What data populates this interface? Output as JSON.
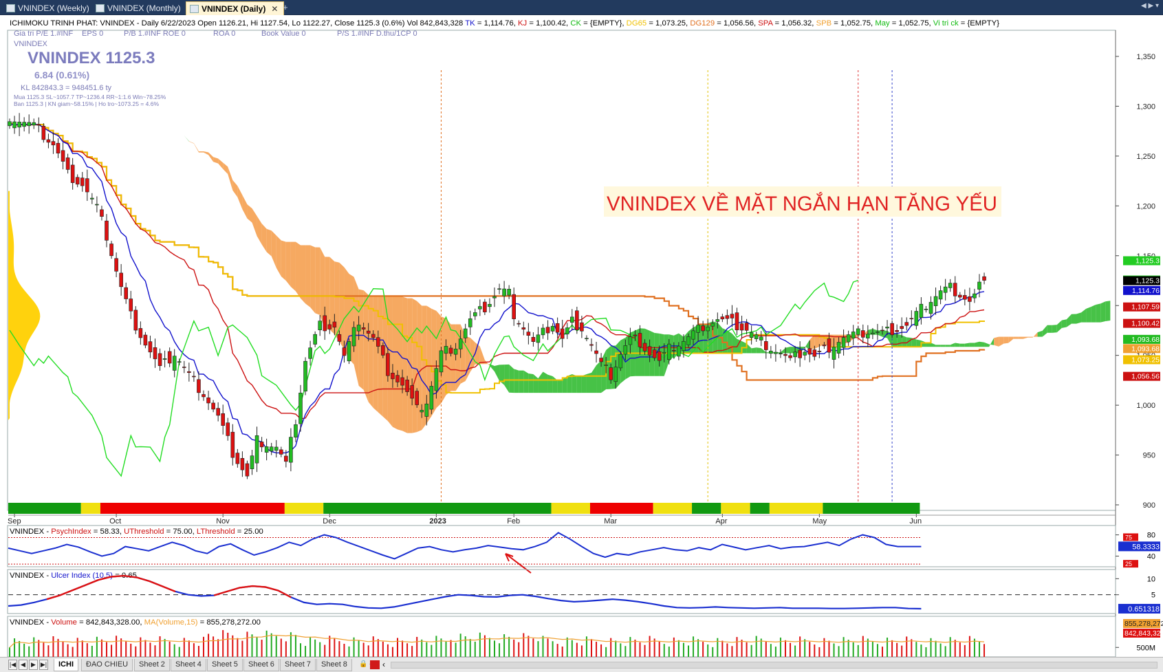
{
  "tabs": [
    {
      "label": "VNINDEX (Weekly)",
      "active": false
    },
    {
      "label": "VNINDEX (Monthly)",
      "active": false
    },
    {
      "label": "VNINDEX (Daily)",
      "active": true
    }
  ],
  "new_tab_symbol": "+",
  "tab_close_symbol": "✕",
  "tab_scroll_symbols": "◀ ▶ ▾",
  "header": {
    "line1": [
      {
        "text": "ICHIMOKU TRINH PHAT: VNINDEX - Daily 6/22/2023 Open 1126.21, Hi 1127.54, Lo 1122.27, Close 1125.3 (0.6%) Vol 842,843,328 ",
        "color": "#000000"
      },
      {
        "text": "TK",
        "color": "#1111cc"
      },
      {
        "text": " = 1,114.76, ",
        "color": "#000000"
      },
      {
        "text": "KJ",
        "color": "#cc1111"
      },
      {
        "text": " = 1,100.42, ",
        "color": "#000000"
      },
      {
        "text": "CK",
        "color": "#11bb11"
      },
      {
        "text": " = {EMPTY}, ",
        "color": "#000000"
      },
      {
        "text": "DG65",
        "color": "#f0c000"
      },
      {
        "text": " = 1,073.25, ",
        "color": "#000000"
      },
      {
        "text": "DG129",
        "color": "#e07020"
      },
      {
        "text": " = 1,056.56, ",
        "color": "#000000"
      },
      {
        "text": "SPA",
        "color": "#cc1111"
      },
      {
        "text": " = 1,056.32, ",
        "color": "#000000"
      },
      {
        "text": "SPB",
        "color": "#f0a030"
      },
      {
        "text": " = 1,052.75, ",
        "color": "#000000"
      },
      {
        "text": "May",
        "color": "#11bb11"
      },
      {
        "text": " = 1,052.75, ",
        "color": "#000000"
      },
      {
        "text": "Vi tri ck",
        "color": "#11bb11"
      },
      {
        "text": " = {EMPTY}",
        "color": "#000000"
      }
    ],
    "line2": [
      "Gia tri P/E 1.#INF",
      "EPS 0",
      "P/B 1.#INF ROE 0",
      "ROA 0",
      "Book Value 0",
      "P/S 1.#INF D.thu/1CP 0"
    ],
    "line3": "VNINDEX",
    "big_title": "VNINDEX 1125.3",
    "change": "6.84 (0.61%)",
    "kl": "KL 842843.3 = 948451.6 ty",
    "mua": "Mua 1125.3   SL~1057.7   TP~1236.4   RR~1:1.6   Win~78.25%",
    "ban": "Ban 1125.3 | KN giam~58.15% | Ho tro~1073.25 = 4.6%"
  },
  "annotation": "VNINDEX VỀ MẶT NGẮN HẠN TĂNG YẾU",
  "colors": {
    "up": "#22bb22",
    "down": "#dd1111",
    "tenkan": "#1111cc",
    "kijun": "#cc1111",
    "chikou": "#22dd22",
    "dg65": "#f0c000",
    "dg129": "#e07020",
    "kumo_bull": "#33bb33",
    "kumo_bear": "#f5a050",
    "accent": "#223a5e"
  },
  "chart_data": [
    {
      "type": "candlestick",
      "title": "ICHIMOKU TRINH PHAT: VNINDEX - Daily",
      "ylim": [
        885,
        1365
      ],
      "ytick_values": [
        900,
        950,
        1000,
        1050,
        1100,
        1150,
        1200,
        1250,
        1300,
        1350
      ],
      "ytick_labels": [
        "900",
        "950",
        "1,000",
        "1,050",
        "1,100",
        "1,150",
        "1,200",
        "1,250",
        "1,300",
        "1,350"
      ],
      "months": [
        {
          "label": "Sep",
          "idx": 1
        },
        {
          "label": "Oct",
          "idx": 22
        },
        {
          "label": "Nov",
          "idx": 44
        },
        {
          "label": "Dec",
          "idx": 66
        },
        {
          "label": "2023",
          "idx": 88
        },
        {
          "label": "Feb",
          "idx": 104
        },
        {
          "label": "Mar",
          "idx": 124
        },
        {
          "label": "Apr",
          "idx": 147
        },
        {
          "label": "May",
          "idx": 167
        },
        {
          "label": "Jun",
          "idx": 187
        }
      ],
      "close_anchors": [
        [
          0,
          1290
        ],
        [
          5,
          1280
        ],
        [
          9,
          1262
        ],
        [
          12,
          1232
        ],
        [
          15,
          1222
        ],
        [
          18,
          1198
        ],
        [
          20,
          1170
        ],
        [
          23,
          1118
        ],
        [
          25,
          1090
        ],
        [
          28,
          1062
        ],
        [
          31,
          1036
        ],
        [
          34,
          1052
        ],
        [
          37,
          1030
        ],
        [
          40,
          1012
        ],
        [
          43,
          988
        ],
        [
          46,
          952
        ],
        [
          49,
          928
        ],
        [
          51,
          965
        ],
        [
          53,
          962
        ],
        [
          55,
          958
        ],
        [
          57,
          940
        ],
        [
          59,
          985
        ],
        [
          61,
          1045
        ],
        [
          64,
          1080
        ],
        [
          67,
          1080
        ],
        [
          69,
          1048
        ],
        [
          72,
          1085
        ],
        [
          75,
          1067
        ],
        [
          78,
          1035
        ],
        [
          81,
          1020
        ],
        [
          84,
          995
        ],
        [
          86,
          1004
        ],
        [
          89,
          1052
        ],
        [
          92,
          1060
        ],
        [
          95,
          1085
        ],
        [
          98,
          1098
        ],
        [
          101,
          1116
        ],
        [
          103,
          1112
        ],
        [
          104,
          1092
        ],
        [
          106,
          1078
        ],
        [
          108,
          1062
        ],
        [
          110,
          1072
        ],
        [
          112,
          1082
        ],
        [
          114,
          1066
        ],
        [
          116,
          1084
        ],
        [
          118,
          1078
        ],
        [
          120,
          1060
        ],
        [
          122,
          1040
        ],
        [
          124,
          1030
        ],
        [
          126,
          1052
        ],
        [
          128,
          1066
        ],
        [
          130,
          1064
        ],
        [
          132,
          1052
        ],
        [
          134,
          1043
        ],
        [
          136,
          1056
        ],
        [
          138,
          1062
        ],
        [
          140,
          1068
        ],
        [
          143,
          1080
        ],
        [
          146,
          1086
        ],
        [
          149,
          1082
        ],
        [
          152,
          1076
        ],
        [
          155,
          1064
        ],
        [
          157,
          1058
        ],
        [
          159,
          1052
        ],
        [
          161,
          1044
        ],
        [
          164,
          1056
        ],
        [
          166,
          1048
        ],
        [
          168,
          1055
        ],
        [
          170,
          1062
        ],
        [
          172,
          1068
        ],
        [
          174,
          1070
        ],
        [
          177,
          1074
        ],
        [
          180,
          1072
        ],
        [
          182,
          1076
        ],
        [
          185,
          1080
        ],
        [
          188,
          1096
        ],
        [
          190,
          1106
        ],
        [
          192,
          1114
        ],
        [
          194,
          1118
        ],
        [
          196,
          1112
        ],
        [
          198,
          1104
        ],
        [
          199,
          1110
        ],
        [
          200,
          1120
        ],
        [
          201,
          1125.3
        ]
      ],
      "price_labels": [
        {
          "value": 1125.3,
          "text": "1,125.3",
          "bg": "#22cc22"
        },
        {
          "value": 1114.76,
          "text": "1,114.76",
          "bg": "#1111cc"
        },
        {
          "value": 1107.59,
          "text": "1,107.59",
          "bg": "#cc1111"
        },
        {
          "value": 1100.42,
          "text": "1,100.42",
          "bg": "#cc1111"
        },
        {
          "value": 1093.68,
          "text": "1,093.68",
          "bg": "#22bb22"
        },
        {
          "value": 1093.68,
          "text": "1,093.68",
          "bg": "#f0a030"
        },
        {
          "value": 1073.25,
          "text": "1,073.25",
          "bg": "#f0c000"
        },
        {
          "value": 1056.56,
          "text": "1,056.56",
          "bg": "#cc1111"
        }
      ]
    },
    {
      "type": "line",
      "title": "VNINDEX - PsychIndex = 58.33, UThreshold = 75.00, LThreshold = 25.00",
      "title_parts": [
        {
          "text": "VNINDEX - ",
          "color": "#000"
        },
        {
          "text": "PsychIndex",
          "color": "#cc1111"
        },
        {
          "text": " = 58.33, ",
          "color": "#000"
        },
        {
          "text": "UThreshold",
          "color": "#cc1111"
        },
        {
          "text": " = 75.00, ",
          "color": "#000"
        },
        {
          "text": "LThreshold",
          "color": "#cc1111"
        },
        {
          "text": " = 25.00",
          "color": "#000"
        }
      ],
      "ylim": [
        20,
        95
      ],
      "tick_labels": [
        "80",
        "40"
      ],
      "upper": 75,
      "lower": 25,
      "last_value_label": "58.3333",
      "label_upper": "75",
      "label_lower": "25",
      "values": [
        55,
        50,
        45,
        50,
        55,
        62,
        57,
        48,
        40,
        45,
        58,
        54,
        50,
        58,
        66,
        60,
        50,
        45,
        58,
        63,
        52,
        42,
        48,
        56,
        66,
        60,
        72,
        80,
        75,
        66,
        58,
        50,
        42,
        35,
        45,
        55,
        58,
        52,
        48,
        52,
        55,
        60,
        57,
        54,
        52,
        58,
        66,
        84,
        72,
        58,
        45,
        38,
        45,
        42,
        48,
        52,
        56,
        52,
        50,
        56,
        52,
        62,
        57,
        52,
        56,
        60,
        54,
        57,
        58,
        62,
        66,
        60,
        72,
        80,
        75,
        62,
        58,
        58,
        58
      ]
    },
    {
      "type": "line",
      "title": "VNINDEX - Ulcer Index (10,5) = 0.65",
      "title_parts": [
        {
          "text": "VNINDEX - ",
          "color": "#000"
        },
        {
          "text": "Ulcer Index (10,5)",
          "color": "#1111cc"
        },
        {
          "text": " = 0.65",
          "color": "#000"
        }
      ],
      "ylim": [
        0,
        12
      ],
      "tick_labels": [
        "10",
        "5"
      ],
      "dashed_level": 5,
      "last_value_label": "0.651318",
      "values": [
        1.5,
        1.8,
        2.6,
        3.6,
        4.8,
        6.4,
        8.0,
        9.6,
        10.6,
        10.9,
        10.4,
        9.2,
        7.6,
        6.0,
        5.0,
        4.6,
        4.8,
        6.0,
        7.2,
        7.7,
        7.4,
        6.3,
        4.2,
        2.6,
        2.0,
        2.2,
        2.0,
        1.3,
        0.9,
        0.8,
        1.2,
        2.0,
        2.8,
        3.6,
        4.4,
        5.0,
        4.8,
        4.4,
        4.3,
        4.8,
        5.0,
        4.5,
        3.8,
        3.2,
        2.8,
        3.0,
        3.3,
        3.6,
        3.3,
        2.8,
        2.2,
        1.5,
        1.0,
        0.9,
        1.0,
        1.2,
        1.0,
        0.9,
        0.8,
        0.9,
        1.0,
        0.8,
        0.8,
        0.8,
        0.7,
        0.7,
        0.8,
        0.9,
        1.0,
        1.0,
        0.7,
        0.65
      ]
    },
    {
      "type": "bar",
      "title": "VNINDEX - Volume = 842,843,328.00, MA(Volume,15) = 855,278,272.00",
      "title_parts": [
        {
          "text": "VNINDEX - ",
          "color": "#000"
        },
        {
          "text": "Volume",
          "color": "#cc1111"
        },
        {
          "text": " = 842,843,328.00, ",
          "color": "#000"
        },
        {
          "text": "MA(Volume,15)",
          "color": "#f0a030"
        },
        {
          "text": " = 855,278,272.00",
          "color": "#000"
        }
      ],
      "tick_labels": [
        "500M"
      ],
      "label_ma": "855,278,272",
      "label_vol": "842,843,328",
      "unit": "M",
      "ylim": [
        0,
        2000
      ]
    }
  ],
  "sheets": [
    "ICHI",
    "ĐAO CHIEU",
    "Sheet 2",
    "Sheet 4",
    "Sheet 5",
    "Sheet 6",
    "Sheet 7",
    "Sheet 8"
  ],
  "sheet_nav": [
    "|◀",
    "◀",
    "▶",
    "▶|"
  ],
  "sheet_misc": "🔒 ◂▸",
  "scroll_arrow": "‹"
}
